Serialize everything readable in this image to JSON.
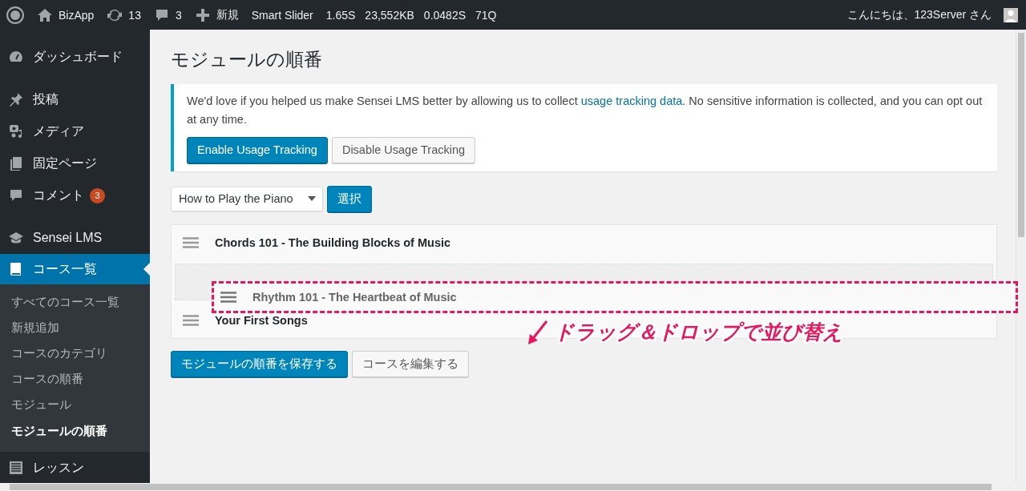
{
  "admin_bar": {
    "items": [
      {
        "kind": "logo"
      },
      {
        "kind": "home",
        "label": "BizApp"
      },
      {
        "kind": "updates",
        "label": "13"
      },
      {
        "kind": "comments",
        "label": "3"
      },
      {
        "kind": "new",
        "label": "新規"
      },
      {
        "kind": "text",
        "label": "Smart Slider"
      }
    ],
    "stats": [
      "1.65S",
      "23,552KB",
      "0.0482S",
      "71Q"
    ],
    "greeting": "こんにちは、123Server さん"
  },
  "sidebar": {
    "items": [
      {
        "kind": "dashboard",
        "label": "ダッシュボード",
        "selected": false
      },
      {
        "kind": "pin",
        "label": "投稿",
        "selected": false
      },
      {
        "kind": "media",
        "label": "メディア",
        "selected": false
      },
      {
        "kind": "pages",
        "label": "固定ページ",
        "selected": false
      },
      {
        "kind": "comment",
        "label": "コメント",
        "selected": false,
        "badge": "3"
      },
      {
        "kind": "cap",
        "label": "Sensei LMS",
        "selected": false
      },
      {
        "kind": "book",
        "label": "コース一覧",
        "selected": true,
        "children": [
          {
            "label": "すべてのコース一覧",
            "selected": false
          },
          {
            "label": "新規追加",
            "selected": false
          },
          {
            "label": "コースのカテゴリ",
            "selected": false
          },
          {
            "label": "コースの順番",
            "selected": false
          },
          {
            "label": "モジュール",
            "selected": false
          },
          {
            "label": "モジュールの順番",
            "selected": true
          }
        ]
      },
      {
        "kind": "list",
        "label": "レッスン",
        "selected": false
      }
    ]
  },
  "main": {
    "title": "モジュールの順番",
    "notice": {
      "text_before": "We'd love if you helped us make Sensei LMS better by allowing us to collect ",
      "link": "usage tracking data",
      "text_after": ". No sensitive information is collected, and you can opt out at any time.",
      "buttons": [
        {
          "label": "Enable Usage Tracking",
          "primary": true
        },
        {
          "label": "Disable Usage Tracking",
          "primary": false
        }
      ]
    },
    "course_select": {
      "value": "How to Play the Piano",
      "button": "選択"
    },
    "modules": [
      {
        "title": "Chords 101 - The Building Blocks of Music",
        "dragging": false
      },
      {
        "title": "Rhythm 101 - The Heartbeat of Music",
        "dragging": true
      },
      {
        "title": "Your First Songs",
        "dragging": false
      }
    ],
    "annotation": "ドラッグ＆ドロップで並び替え",
    "buttons": [
      {
        "label": "モジュールの順番を保存する",
        "primary": true
      },
      {
        "label": "コースを編集する",
        "primary": false
      }
    ]
  }
}
